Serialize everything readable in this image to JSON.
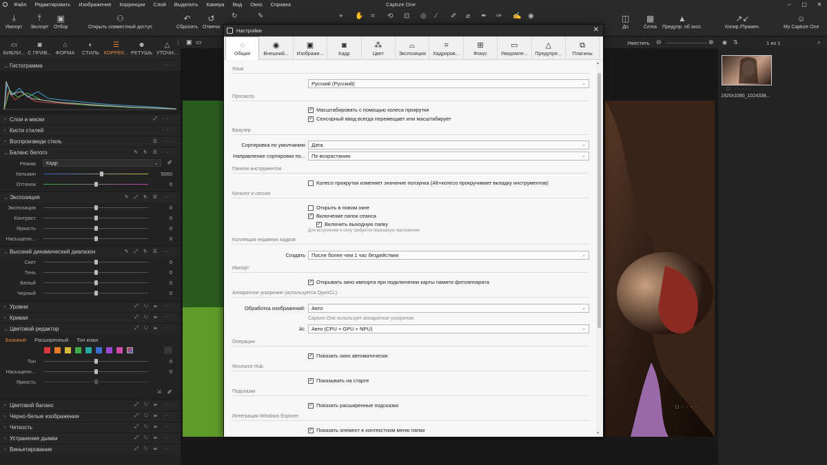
{
  "menubar": {
    "items": [
      "Файл",
      "Редактировать",
      "Изображение",
      "Коррекции",
      "Слой",
      "Выделить",
      "Камера",
      "Вид",
      "Окно",
      "Справка"
    ],
    "app_title": "Capture One"
  },
  "toolbar": {
    "left_buttons": [
      "Импорт",
      "Экспорт",
      "Отбор"
    ],
    "share": "Открыть совместный доступ",
    "undo": "Сбросить",
    "cancel": "Отмена",
    "right_buttons": [
      "До",
      "Сетка",
      "Предупр. об эксп.",
      "Копир./Примен.",
      "My Capture One"
    ]
  },
  "left_panel": {
    "tabs": [
      {
        "label": "БИБЛИ...",
        "icon": "folder-icon"
      },
      {
        "label": "С ПРИВ...",
        "icon": "camera-icon"
      },
      {
        "label": "ФОРМА",
        "icon": "shape-icon"
      },
      {
        "label": "СТИЛЬ",
        "icon": "style-icon"
      },
      {
        "label": "КОРРЕК...",
        "icon": "adjust-icon"
      },
      {
        "label": "РЕТУШЬ",
        "icon": "retouch-icon"
      },
      {
        "label": "УТОЧН...",
        "icon": "refine-icon"
      }
    ],
    "histogram": "Гистограмма",
    "sections": {
      "layers": "Слои и маски",
      "style_brushes": "Кисти стилей",
      "reproduce_style": "Воспроизведи стиль",
      "white_balance": "Баланс белого",
      "mode_label": "Режим",
      "mode_value": "Кадр",
      "kelvin_label": "Кельвин",
      "kelvin_value": "5000",
      "tint_label": "Оттенок",
      "tint_value": "0",
      "exposure": "Экспозиция",
      "exposure_rows": [
        {
          "label": "Экспозиция",
          "value": "0"
        },
        {
          "label": "Контраст",
          "value": "0"
        },
        {
          "label": "Яркость",
          "value": "0"
        },
        {
          "label": "Насыщенн...",
          "value": "0"
        }
      ],
      "hdr": "Высокий динамический диапазон",
      "hdr_rows": [
        {
          "label": "Свет",
          "value": "0"
        },
        {
          "label": "Тень",
          "value": "0"
        },
        {
          "label": "Белый",
          "value": "0"
        },
        {
          "label": "Черный",
          "value": "0"
        }
      ],
      "levels": "Уровни",
      "curve": "Кривая",
      "color_editor": "Цветовой редактор",
      "color_tabs": [
        "Базовый",
        "Расширенный",
        "Тон кожи"
      ],
      "color_rows": [
        {
          "label": "Тон",
          "value": "0"
        },
        {
          "label": "Насыщенн...",
          "value": "0"
        },
        {
          "label": "Яркость",
          "value": ""
        }
      ],
      "color_balance": "Цветовой баланс",
      "bw": "Черно-белые изображения",
      "clarity": "Четкость",
      "dehaze": "Устранение дымки",
      "vignette": "Виньетирование"
    },
    "swatches": [
      "#d9363e",
      "#e87b2a",
      "#d8b83a",
      "#3fae49",
      "#2aa8a0",
      "#3a6fd0",
      "#9a4ad0",
      "#d04aa8"
    ]
  },
  "viewer": {
    "fit_label": "Уместить"
  },
  "right_panel": {
    "counter": "1 из 1",
    "thumb_name": "1920x1080_1024338..."
  },
  "dialog": {
    "title": "Настройки",
    "tabs": [
      {
        "label": "Общие",
        "icon": "general-icon"
      },
      {
        "label": "Внешний...",
        "icon": "eye-icon"
      },
      {
        "label": "Изображе...",
        "icon": "image-icon"
      },
      {
        "label": "Кадр",
        "icon": "camera-icon"
      },
      {
        "label": "Цвет",
        "icon": "color-icon"
      },
      {
        "label": "Экспозиция",
        "icon": "exposure-icon"
      },
      {
        "label": "Кадриров...",
        "icon": "crop-icon"
      },
      {
        "label": "Фокус",
        "icon": "focus-icon"
      },
      {
        "label": "Уведомле...",
        "icon": "notify-icon"
      },
      {
        "label": "Предупре...",
        "icon": "warning-icon"
      },
      {
        "label": "Плагины",
        "icon": "plugin-icon"
      }
    ],
    "language": {
      "group": "Язык",
      "value": "Русский (Русский)"
    },
    "view": {
      "group": "Просмотр",
      "opt1": "Масштабировать с помощью колеса прокрутки",
      "opt2": "Сенсорный ввод всегда перемещает или масштабирует"
    },
    "browser": {
      "group": "Браузер",
      "sort_label": "Сортировка по умолчанию",
      "sort_value": "Дата",
      "dir_label": "Направление сортировки по...",
      "dir_value": "По возрастанию"
    },
    "tool_panels": {
      "group": "Панели инструментов",
      "opt": "Колесо прокрутки изменяет значение ползунка (Alt+колесо прокручивает вкладку инструментов)"
    },
    "catalog": {
      "group": "Каталог и сессия",
      "opt1": "Открыть в новом окне",
      "opt2": "Включение папок сеанса",
      "opt3": "Включить выходную папку",
      "note": "Для вступления в силу требуется перезапуск приложения"
    },
    "recent": {
      "group": "Коллекция недавних кадров",
      "label": "Создать",
      "value": "После более чем 1 час бездействия"
    },
    "import": {
      "group": "Импорт",
      "opt": "Открывать окно импорта при подключении карты памяти фотоаппарата"
    },
    "opencl": {
      "group": "Аппаратное ускорение (используется OpenCL)",
      "label": "Обработка изображений:",
      "value": "Авто",
      "note": "Capture One использует аппаратное ускорение.",
      "ai_label": "AI:",
      "ai_value": "Авто (CPU + GPU + NPU)"
    },
    "operations": {
      "group": "Операции",
      "opt": "Показать окно автоматически"
    },
    "resource": {
      "group": "Resource Hub",
      "opt": "Показывать на старте"
    },
    "hints": {
      "group": "Подсказки",
      "opt": "Показать расширенные подсказки"
    },
    "explorer": {
      "group": "Интеграция Windows Explorer",
      "opt": "Показать элемент в контекстном меню папки"
    }
  }
}
